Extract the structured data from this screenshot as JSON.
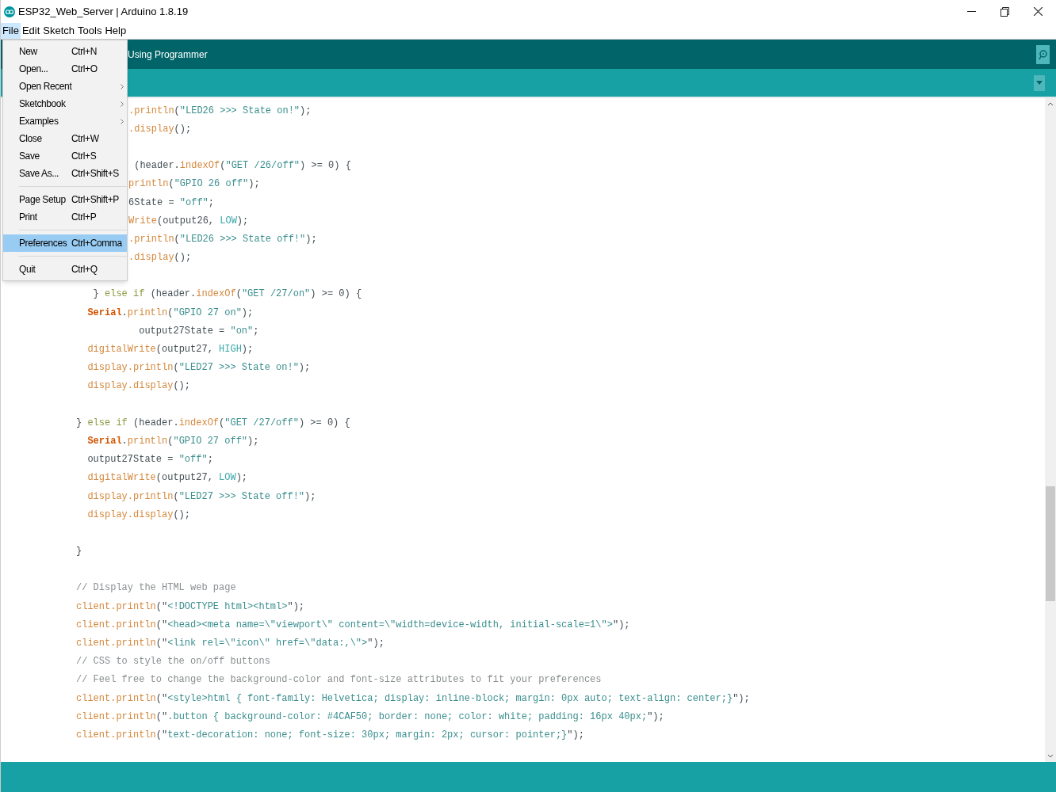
{
  "window": {
    "title": "ESP32_Web_Server | Arduino 1.8.19"
  },
  "menubar": [
    {
      "label": "File",
      "selected": true
    },
    {
      "label": "Edit",
      "selected": false
    },
    {
      "label": "Sketch",
      "selected": false
    },
    {
      "label": "Tools",
      "selected": false
    },
    {
      "label": "Help",
      "selected": false
    }
  ],
  "file_menu": [
    {
      "kind": "item",
      "label": "New",
      "shortcut": "Ctrl+N",
      "selected": false
    },
    {
      "kind": "item",
      "label": "Open...",
      "shortcut": "Ctrl+O",
      "selected": false
    },
    {
      "kind": "submenu",
      "label": "Open Recent",
      "selected": false
    },
    {
      "kind": "submenu",
      "label": "Sketchbook",
      "selected": false
    },
    {
      "kind": "submenu",
      "label": "Examples",
      "selected": false
    },
    {
      "kind": "item",
      "label": "Close",
      "shortcut": "Ctrl+W",
      "selected": false
    },
    {
      "kind": "item",
      "label": "Save",
      "shortcut": "Ctrl+S",
      "selected": false
    },
    {
      "kind": "item",
      "label": "Save As...",
      "shortcut": "Ctrl+Shift+S",
      "selected": false
    },
    {
      "kind": "separator"
    },
    {
      "kind": "item",
      "label": "Page Setup",
      "shortcut": "Ctrl+Shift+P",
      "selected": false
    },
    {
      "kind": "item",
      "label": "Print",
      "shortcut": "Ctrl+P",
      "selected": false
    },
    {
      "kind": "separator"
    },
    {
      "kind": "item",
      "label": "Preferences",
      "shortcut": "Ctrl+Comma",
      "selected": true
    },
    {
      "kind": "separator"
    },
    {
      "kind": "item",
      "label": "Quit",
      "shortcut": "Ctrl+Q",
      "selected": false
    }
  ],
  "toolbar": {
    "status": "Using Programmer"
  },
  "code_lines": [
    {
      "kind": "code",
      "tokens": [
        {
          "kind": "fn",
          "text": ".println"
        },
        {
          "kind": "plain",
          "text": "("
        },
        {
          "kind": "string",
          "text": "\"LED26 >>> State on!\""
        },
        {
          "kind": "plain",
          "text": ");"
        }
      ]
    },
    {
      "kind": "code",
      "tokens": [
        {
          "kind": "fn",
          "text": ".display"
        },
        {
          "kind": "plain",
          "text": "();"
        }
      ]
    },
    {
      "kind": "blank"
    },
    {
      "kind": "code",
      "tokens": [
        {
          "kind": "plain",
          "text": " (header."
        },
        {
          "kind": "fn",
          "text": "indexOf"
        },
        {
          "kind": "plain",
          "text": "("
        },
        {
          "kind": "string",
          "text": "\"GET /26/off\""
        },
        {
          "kind": "plain",
          "text": ") >= 0) {"
        }
      ]
    },
    {
      "kind": "code",
      "tokens": [
        {
          "kind": "fn",
          "text": "println"
        },
        {
          "kind": "plain",
          "text": "("
        },
        {
          "kind": "string",
          "text": "\"GPIO 26 off\""
        },
        {
          "kind": "plain",
          "text": ");"
        }
      ]
    },
    {
      "kind": "code",
      "tokens": [
        {
          "kind": "plain",
          "text": "6State = "
        },
        {
          "kind": "string",
          "text": "\"off\""
        },
        {
          "kind": "plain",
          "text": ";"
        }
      ]
    },
    {
      "kind": "code",
      "tokens": [
        {
          "kind": "fn",
          "text": "Write"
        },
        {
          "kind": "plain",
          "text": "(output26, "
        },
        {
          "kind": "const",
          "text": "LOW"
        },
        {
          "kind": "plain",
          "text": ");"
        }
      ]
    },
    {
      "kind": "code",
      "tokens": [
        {
          "kind": "fn",
          "text": ".println"
        },
        {
          "kind": "plain",
          "text": "("
        },
        {
          "kind": "string",
          "text": "\"LED26 >>> State off!\""
        },
        {
          "kind": "plain",
          "text": ");"
        }
      ]
    },
    {
      "kind": "code",
      "tokens": [
        {
          "kind": "fn",
          "text": ".display"
        },
        {
          "kind": "plain",
          "text": "();"
        }
      ]
    },
    {
      "kind": "blank"
    },
    {
      "kind": "code",
      "tokens": [
        {
          "kind": "plain",
          "text": "   } "
        },
        {
          "kind": "keyword",
          "text": "else if"
        },
        {
          "kind": "plain",
          "text": " (header."
        },
        {
          "kind": "fn",
          "text": "indexOf"
        },
        {
          "kind": "plain",
          "text": "("
        },
        {
          "kind": "string",
          "text": "\"GET /27/on\""
        },
        {
          "kind": "plain",
          "text": ") >= 0) {"
        }
      ]
    },
    {
      "kind": "code",
      "tokens": [
        {
          "kind": "serial",
          "text": "  Serial"
        },
        {
          "kind": "plain",
          "text": "."
        },
        {
          "kind": "fn",
          "text": "println"
        },
        {
          "kind": "plain",
          "text": "("
        },
        {
          "kind": "string",
          "text": "\"GPIO 27 on\""
        },
        {
          "kind": "plain",
          "text": ");"
        }
      ]
    },
    {
      "kind": "code",
      "tokens": [
        {
          "kind": "plain",
          "text": "           output27State = "
        },
        {
          "kind": "string",
          "text": "\"on\""
        },
        {
          "kind": "plain",
          "text": ";"
        }
      ]
    },
    {
      "kind": "code",
      "tokens": [
        {
          "kind": "fn",
          "text": "  digitalWrite"
        },
        {
          "kind": "plain",
          "text": "(output27, "
        },
        {
          "kind": "const",
          "text": "HIGH"
        },
        {
          "kind": "plain",
          "text": ");"
        }
      ]
    },
    {
      "kind": "code",
      "tokens": [
        {
          "kind": "fn",
          "text": "  display.println"
        },
        {
          "kind": "plain",
          "text": "("
        },
        {
          "kind": "string",
          "text": "\"LED27 >>> State on!\""
        },
        {
          "kind": "plain",
          "text": ");"
        }
      ]
    },
    {
      "kind": "code",
      "tokens": [
        {
          "kind": "fn",
          "text": "  display.display"
        },
        {
          "kind": "plain",
          "text": "();"
        }
      ]
    },
    {
      "kind": "blank"
    },
    {
      "kind": "code",
      "tokens": [
        {
          "kind": "plain",
          "text": "} "
        },
        {
          "kind": "keyword",
          "text": "else if"
        },
        {
          "kind": "plain",
          "text": " (header."
        },
        {
          "kind": "fn",
          "text": "indexOf"
        },
        {
          "kind": "plain",
          "text": "("
        },
        {
          "kind": "string",
          "text": "\"GET /27/off\""
        },
        {
          "kind": "plain",
          "text": ") >= 0) {"
        }
      ]
    },
    {
      "kind": "code",
      "tokens": [
        {
          "kind": "serial",
          "text": "  Serial"
        },
        {
          "kind": "plain",
          "text": "."
        },
        {
          "kind": "fn",
          "text": "println"
        },
        {
          "kind": "plain",
          "text": "("
        },
        {
          "kind": "string",
          "text": "\"GPIO 27 off\""
        },
        {
          "kind": "plain",
          "text": ");"
        }
      ]
    },
    {
      "kind": "code",
      "tokens": [
        {
          "kind": "plain",
          "text": "  output27State = "
        },
        {
          "kind": "string",
          "text": "\"off\""
        },
        {
          "kind": "plain",
          "text": ";"
        }
      ]
    },
    {
      "kind": "code",
      "tokens": [
        {
          "kind": "fn",
          "text": "  digitalWrite"
        },
        {
          "kind": "plain",
          "text": "(output27, "
        },
        {
          "kind": "const",
          "text": "LOW"
        },
        {
          "kind": "plain",
          "text": ");"
        }
      ]
    },
    {
      "kind": "code",
      "tokens": [
        {
          "kind": "fn",
          "text": "  display.println"
        },
        {
          "kind": "plain",
          "text": "("
        },
        {
          "kind": "string",
          "text": "\"LED27 >>> State off!\""
        },
        {
          "kind": "plain",
          "text": ");"
        }
      ]
    },
    {
      "kind": "code",
      "tokens": [
        {
          "kind": "fn",
          "text": "  display.display"
        },
        {
          "kind": "plain",
          "text": "();"
        }
      ]
    },
    {
      "kind": "blank"
    },
    {
      "kind": "code",
      "tokens": [
        {
          "kind": "plain",
          "text": "}"
        }
      ]
    },
    {
      "kind": "blank"
    },
    {
      "kind": "code",
      "tokens": [
        {
          "kind": "comment",
          "text": "// Display the HTML web page"
        }
      ]
    },
    {
      "kind": "code",
      "tokens": [
        {
          "kind": "fn",
          "text": "client.println"
        },
        {
          "kind": "plain",
          "text": "(\""
        },
        {
          "kind": "string",
          "text": "<!DOCTYPE html><html>"
        },
        {
          "kind": "plain",
          "text": "\");"
        }
      ]
    },
    {
      "kind": "code",
      "tokens": [
        {
          "kind": "fn",
          "text": "client.println"
        },
        {
          "kind": "plain",
          "text": "(\""
        },
        {
          "kind": "string",
          "text": "<head><meta name=\\\"viewport\\\" content=\\\"width=device-width, initial-scale=1\\\">"
        },
        {
          "kind": "plain",
          "text": "\");"
        }
      ]
    },
    {
      "kind": "code",
      "tokens": [
        {
          "kind": "fn",
          "text": "client.println"
        },
        {
          "kind": "plain",
          "text": "(\""
        },
        {
          "kind": "string",
          "text": "<link rel=\\\"icon\\\" href=\\\"data:,\\\">"
        },
        {
          "kind": "plain",
          "text": "\");"
        }
      ]
    },
    {
      "kind": "code",
      "tokens": [
        {
          "kind": "comment",
          "text": "// CSS to style the on/off buttons"
        }
      ]
    },
    {
      "kind": "code",
      "tokens": [
        {
          "kind": "comment",
          "text": "// Feel free to change the background-color and font-size attributes to fit your preferences"
        }
      ]
    },
    {
      "kind": "code",
      "tokens": [
        {
          "kind": "fn",
          "text": "client.println"
        },
        {
          "kind": "plain",
          "text": "(\""
        },
        {
          "kind": "string",
          "text": "<style>html { font-family: Helvetica; display: inline-block; margin: 0px auto; text-align: center;}"
        },
        {
          "kind": "plain",
          "text": "\");"
        }
      ]
    },
    {
      "kind": "code",
      "tokens": [
        {
          "kind": "fn",
          "text": "client.println"
        },
        {
          "kind": "plain",
          "text": "(\""
        },
        {
          "kind": "string",
          "text": ".button { background-color: #4CAF50; border: none; color: white; padding: 16px 40px;"
        },
        {
          "kind": "plain",
          "text": "\");"
        }
      ]
    },
    {
      "kind": "code",
      "tokens": [
        {
          "kind": "fn",
          "text": "client.println"
        },
        {
          "kind": "plain",
          "text": "(\""
        },
        {
          "kind": "string",
          "text": "text-decoration: none; font-size: 30px; margin: 2px; cursor: pointer;}"
        },
        {
          "kind": "plain",
          "text": "\");"
        }
      ]
    }
  ]
}
